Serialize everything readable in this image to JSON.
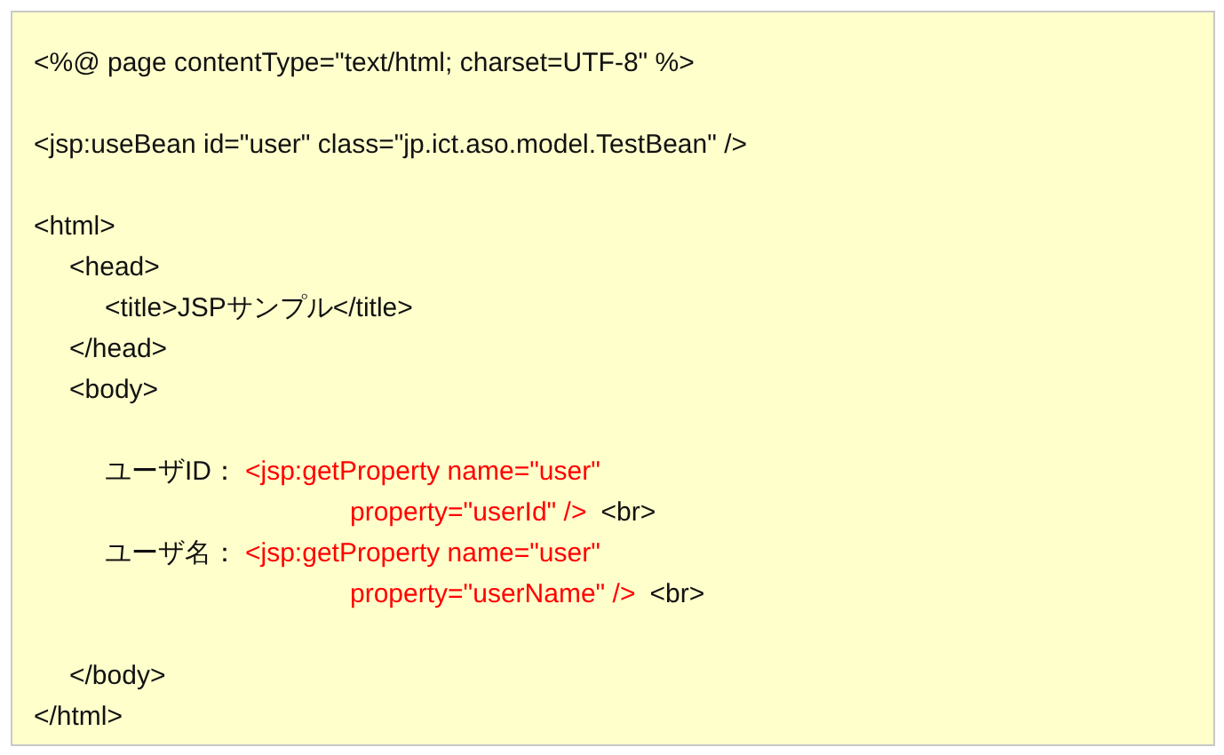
{
  "code": [
    {
      "kind": "line",
      "text": "<%@ page contentType=\"text/html; charset=UTF-8\" %>"
    },
    {
      "kind": "blank"
    },
    {
      "kind": "line",
      "text": "<jsp:useBean id=\"user\" class=\"jp.ict.aso.model.TestBean\" />"
    },
    {
      "kind": "blank"
    },
    {
      "kind": "line",
      "text": "<html>",
      "children": [
        {
          "kind": "line",
          "text": "<head>",
          "children": [
            {
              "kind": "line",
              "text": "<title>JSPサンプル</title>"
            }
          ]
        },
        {
          "kind": "line",
          "text": "</head>"
        },
        {
          "kind": "line",
          "text": "<body>",
          "children": [
            {
              "kind": "blank"
            },
            {
              "kind": "property",
              "label": "ユーザID：",
              "tag_lines": [
                "<jsp:getProperty name=\"user\"",
                "property=\"userId\" />"
              ],
              "suffix": "<br>"
            },
            {
              "kind": "property",
              "label": "ユーザ名：",
              "tag_lines": [
                "<jsp:getProperty name=\"user\"",
                "property=\"userName\" />"
              ],
              "suffix": "<br>"
            },
            {
              "kind": "blank"
            }
          ]
        },
        {
          "kind": "line",
          "text": "</body>"
        }
      ]
    },
    {
      "kind": "line",
      "text": "</html>"
    }
  ]
}
